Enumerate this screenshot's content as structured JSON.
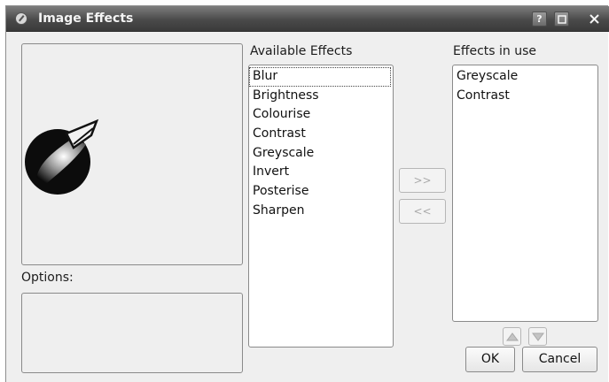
{
  "window": {
    "title": "Image Effects"
  },
  "titlebar": {
    "buttons": [
      {
        "name": "help",
        "label": "?"
      },
      {
        "name": "maximize",
        "label": ""
      },
      {
        "name": "close",
        "label": ""
      }
    ]
  },
  "preview": {
    "logo": "inkscape-pen-logo"
  },
  "options": {
    "label": "Options:"
  },
  "available": {
    "header": "Available Effects",
    "items": [
      "Blur",
      "Brightness",
      "Colourise",
      "Contrast",
      "Greyscale",
      "Invert",
      "Posterise",
      "Sharpen"
    ]
  },
  "in_use": {
    "header": "Effects in use",
    "items": [
      "Greyscale",
      "Contrast"
    ]
  },
  "move_buttons": {
    "add": ">>",
    "remove": "<<"
  },
  "actions": {
    "ok": "OK",
    "cancel": "Cancel"
  },
  "colors": {
    "titlebar": "#4a4a4a",
    "background": "#efefef",
    "list_bg": "#ffffff"
  }
}
